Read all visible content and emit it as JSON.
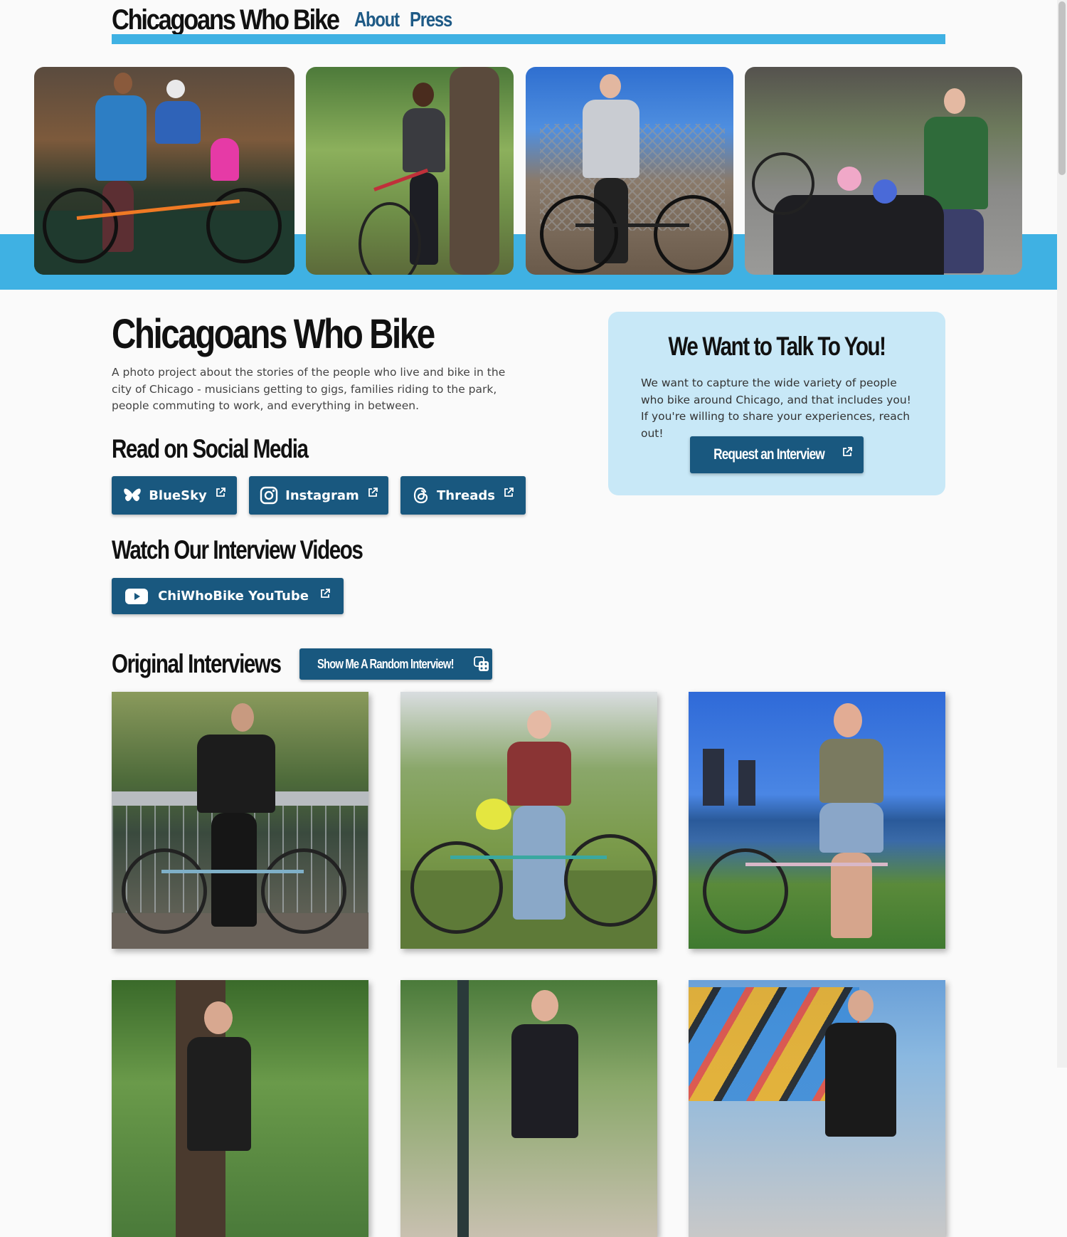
{
  "header": {
    "site_title": "Chicagoans Who Bike",
    "nav": [
      {
        "label": "About"
      },
      {
        "label": "Press"
      }
    ]
  },
  "intro": {
    "title": "Chicagoans Who Bike",
    "description": "A photo project about the stories of the people who live and bike in the city of Chicago - musicians getting to gigs, families riding to the park, people commuting to work, and everything in between."
  },
  "social": {
    "heading": "Read on Social Media",
    "buttons": [
      {
        "label": "BlueSky",
        "icon": "butterfly-icon"
      },
      {
        "label": "Instagram",
        "icon": "instagram-icon"
      },
      {
        "label": "Threads",
        "icon": "threads-icon"
      }
    ]
  },
  "videos": {
    "heading": "Watch Our Interview Videos",
    "button_label": "ChiWhoBike YouTube",
    "icon": "youtube-icon"
  },
  "callout": {
    "heading": "We Want to Talk To You!",
    "body": "We want to capture the wide variety of people who bike around Chicago, and that includes you! If you're willing to share your experiences, reach out!",
    "button_label": "Request an Interview"
  },
  "interviews": {
    "heading": "Original Interviews",
    "random_button_label": "Show Me A Random Interview!",
    "random_icon": "dice-icon"
  },
  "colors": {
    "accent": "#3fb1e3",
    "button": "#19587f",
    "callout_bg": "#c8e8f7",
    "nav_link": "#1e5a86"
  }
}
